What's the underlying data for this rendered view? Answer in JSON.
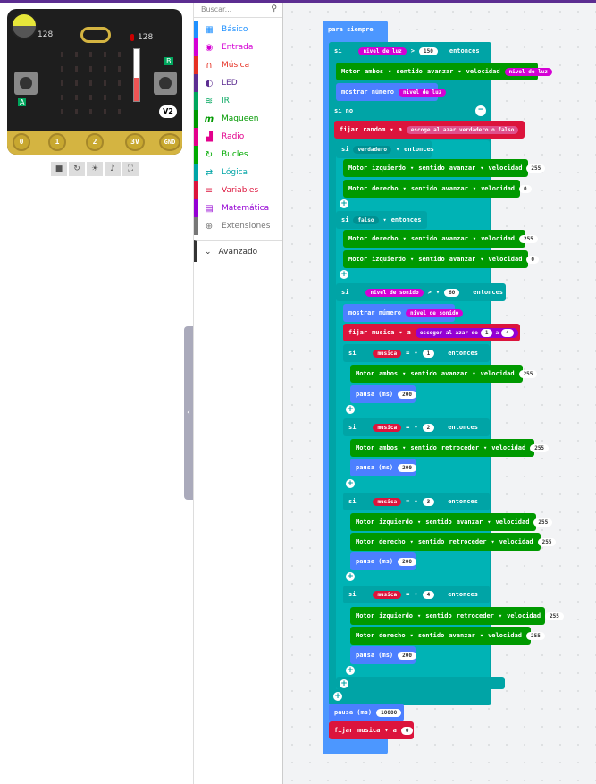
{
  "simulator": {
    "light_value": "128",
    "temp_value": "128",
    "pin_labels": [
      "0",
      "1",
      "2",
      "3V",
      "GND"
    ],
    "btn_a": "A",
    "btn_b": "B",
    "version": "V2"
  },
  "toolbox": {
    "search_placeholder": "Buscar...",
    "categories": [
      {
        "label": "Básico",
        "color": "#1e90ff",
        "icon": "grid-icon",
        "glyph": "▦"
      },
      {
        "label": "Entrada",
        "color": "#d400d4",
        "icon": "target-icon",
        "glyph": "◉"
      },
      {
        "label": "Música",
        "color": "#e63022",
        "icon": "headphones-icon",
        "glyph": "🎧"
      },
      {
        "label": "LED",
        "color": "#5c2d91",
        "icon": "toggle-icon",
        "glyph": "◐"
      },
      {
        "label": "IR",
        "color": "#00a65d",
        "icon": "wifi-icon",
        "glyph": "≋"
      },
      {
        "label": "Maqueen",
        "color": "#009900",
        "icon": "maqueen-icon",
        "glyph": "m"
      },
      {
        "label": "Radio",
        "color": "#e3008c",
        "icon": "signal-icon",
        "glyph": "▟"
      },
      {
        "label": "Bucles",
        "color": "#00aa00",
        "icon": "refresh-icon",
        "glyph": "↻"
      },
      {
        "label": "Lógica",
        "color": "#00a4a6",
        "icon": "shuffle-icon",
        "glyph": "⇄"
      },
      {
        "label": "Variables",
        "color": "#dc143c",
        "icon": "list-icon",
        "glyph": "≡"
      },
      {
        "label": "Matemática",
        "color": "#9400d3",
        "icon": "calculator-icon",
        "glyph": "▤"
      },
      {
        "label": "Extensiones",
        "color": "#777777",
        "icon": "plus-circle-icon",
        "glyph": "⊕"
      }
    ],
    "advanced": "Avanzado"
  },
  "blocks": {
    "forever": "para siempre",
    "if": "si",
    "then": "entonces",
    "else": "si no",
    "light_level": "nivel de luz",
    "gt": ">",
    "eq": "=",
    "v150": "150",
    "motor": "Motor",
    "both": "ambos",
    "left": "izquierdo",
    "right": "derecho",
    "direction": "sentido",
    "forward": "avanzar",
    "backward": "retroceder",
    "speed": "velocidad",
    "show_number": "mostrar número",
    "set": "fijar",
    "random": "random",
    "to": "a",
    "pick_random_bool": "escoge al azar verdadero o falso",
    "true": "verdadero",
    "false": "falso",
    "sound_level": "nivel de sonido",
    "v60": "60",
    "musica": "musica",
    "pick_random": "escoger al azar de",
    "r1": "1",
    "r4": "4",
    "v1": "1",
    "v2": "2",
    "v3": "3",
    "v4": "4",
    "v255": "255",
    "v0": "0",
    "pause": "pausa (ms)",
    "v200": "200",
    "v10000": "10000",
    "plus": "+",
    "minus": "−"
  },
  "colors": {
    "loops": "#4c97ff",
    "logic": "#00a4a6",
    "motor": "#009900",
    "vars": "#dc143c",
    "input": "#d400d4"
  }
}
